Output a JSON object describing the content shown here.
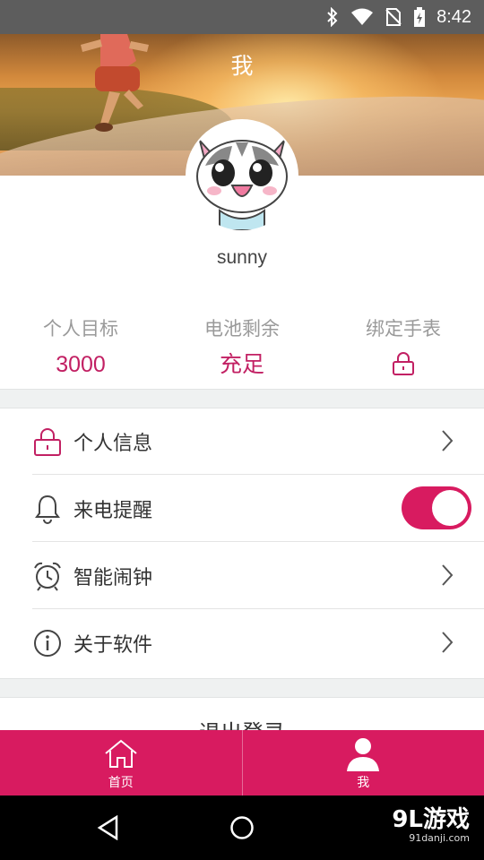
{
  "status_bar": {
    "time": "8:42"
  },
  "header": {
    "title": "我"
  },
  "profile": {
    "username": "sunny"
  },
  "stats": [
    {
      "label": "个人目标",
      "value": "3000"
    },
    {
      "label": "电池剩余",
      "value": "充足"
    },
    {
      "label": "绑定手表",
      "icon": "lock-icon"
    }
  ],
  "menu": [
    {
      "label": "个人信息",
      "icon": "lock-icon",
      "control": "chevron"
    },
    {
      "label": "来电提醒",
      "icon": "bell-icon",
      "control": "toggle",
      "toggle_on": true
    },
    {
      "label": "智能闹钟",
      "icon": "alarm-clock-icon",
      "control": "chevron"
    },
    {
      "label": "关于软件",
      "icon": "info-icon",
      "control": "chevron"
    }
  ],
  "logout": {
    "label": "退出登录"
  },
  "tabbar": [
    {
      "label": "首页",
      "icon": "home-icon"
    },
    {
      "label": "我",
      "icon": "user-icon"
    }
  ],
  "watermark": {
    "brand": "9L游戏",
    "site": "91danji.com"
  },
  "colors": {
    "accent": "#d81b60",
    "status_bar": "#5d5d5d",
    "section_bg": "#eff1f1"
  }
}
